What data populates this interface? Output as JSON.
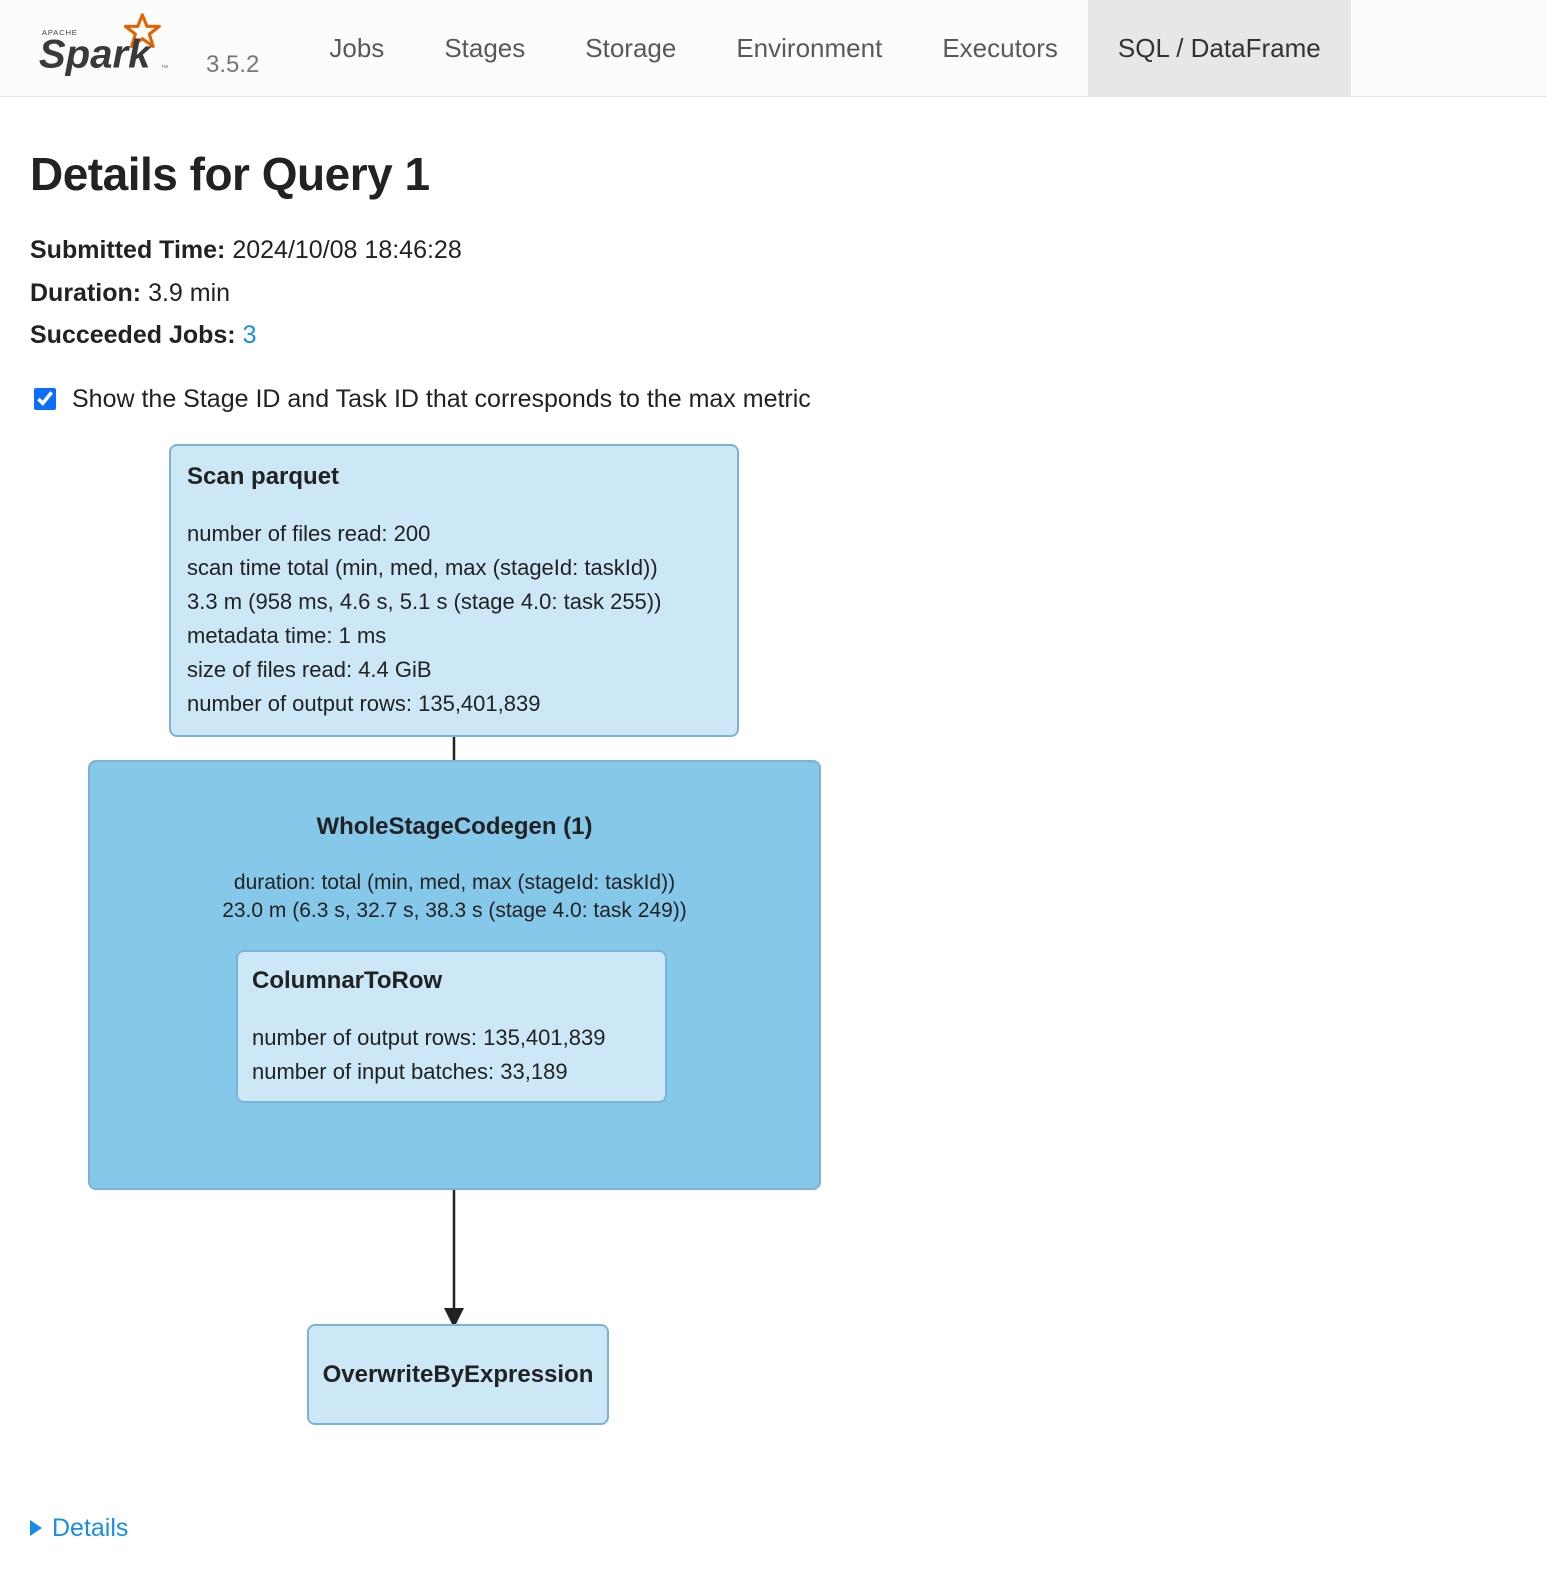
{
  "brand": {
    "version": "3.5.2"
  },
  "nav": {
    "tabs": [
      "Jobs",
      "Stages",
      "Storage",
      "Environment",
      "Executors",
      "SQL / DataFrame"
    ],
    "activeIndex": 5
  },
  "page": {
    "title": "Details for Query 1"
  },
  "meta": {
    "submittedLabel": "Submitted Time:",
    "submittedValue": "2024/10/08 18:46:28",
    "durationLabel": "Duration:",
    "durationValue": "3.9 min",
    "succeededLabel": "Succeeded Jobs:",
    "succeededLink": "3"
  },
  "checkbox": {
    "label": "Show the Stage ID and Task ID that corresponds to the max metric",
    "checked": true
  },
  "plan": {
    "scan": {
      "title": "Scan parquet",
      "lines": [
        "number of files read: 200",
        "scan time total (min, med, max (stageId: taskId))",
        "3.3 m (958 ms, 4.6 s, 5.1 s (stage 4.0: task 255))",
        "metadata time: 1 ms",
        "size of files read: 4.4 GiB",
        "number of output rows: 135,401,839"
      ]
    },
    "wsc": {
      "title": "WholeStageCodegen (1)",
      "line1": "duration: total (min, med, max  (stageId: taskId))",
      "line2": "23.0 m (6.3 s, 32.7 s, 38.3 s  (stage 4.0: task 249))"
    },
    "ctr": {
      "title": "ColumnarToRow",
      "lines": [
        "number of output rows: 135,401,839",
        "number of input batches: 33,189"
      ]
    },
    "ovw": {
      "title": "OverwriteByExpression"
    }
  },
  "details": {
    "label": "Details"
  }
}
